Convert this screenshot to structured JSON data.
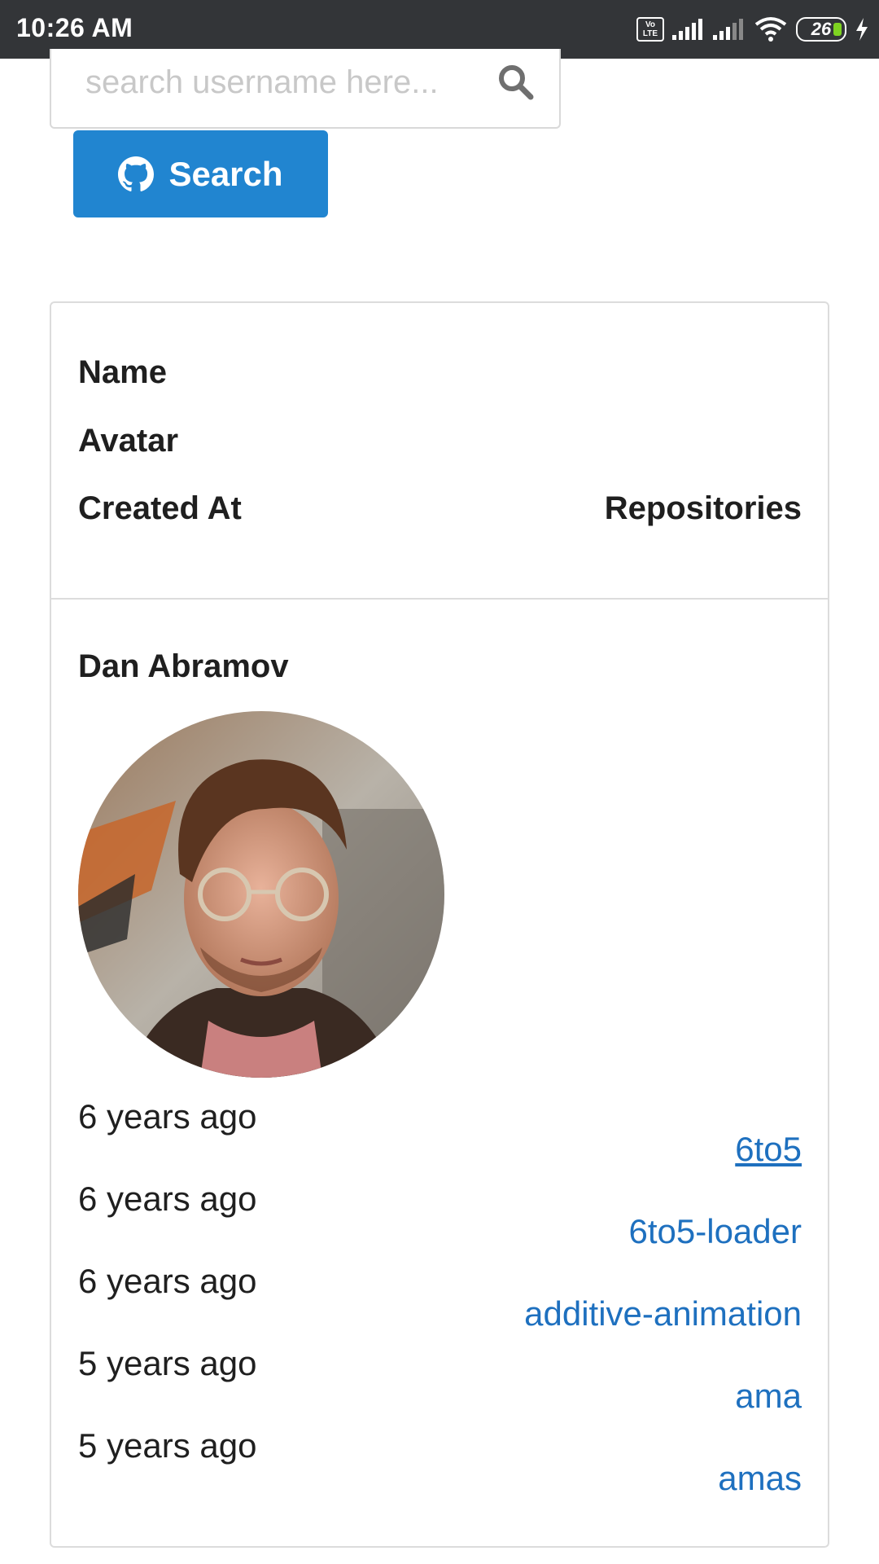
{
  "status_bar": {
    "time": "10:26 AM",
    "volte": "Vo LTE",
    "battery": "26",
    "colors": {
      "background": "#333538",
      "battery_fill": "#7ed321"
    }
  },
  "search": {
    "placeholder": "search username here...",
    "value": "",
    "button_label": "Search",
    "icon": "search-icon",
    "button_icon": "github-icon"
  },
  "table": {
    "headers": {
      "name": "Name",
      "avatar": "Avatar",
      "created_at": "Created At",
      "repositories": "Repositories"
    },
    "user": {
      "name": "Dan Abramov",
      "avatar_icon": "user-photo",
      "created_at": [
        "6 years ago",
        "6 years ago",
        "6 years ago",
        "5 years ago",
        "5 years ago"
      ],
      "repositories": [
        "6to5",
        "6to5-loader",
        "additive-animation",
        "ama",
        "amas"
      ]
    }
  },
  "colors": {
    "primary_button": "#2185d0",
    "link": "#1e70bf",
    "border": "#dcdcdc"
  }
}
